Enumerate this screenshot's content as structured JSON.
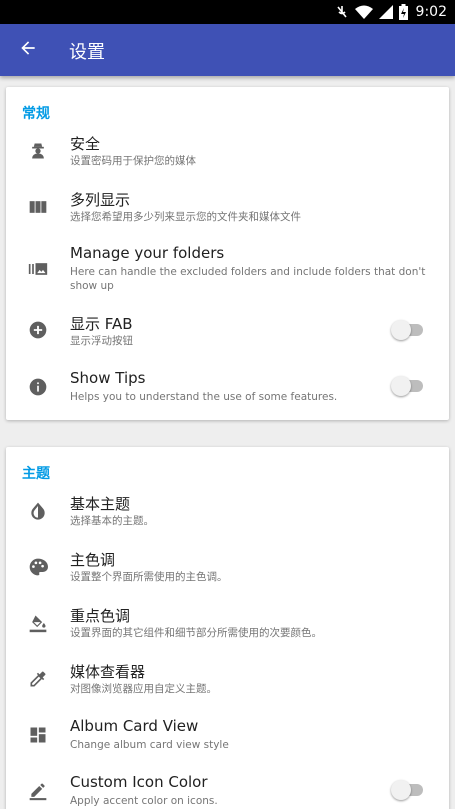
{
  "status_bar": {
    "time": "9:02"
  },
  "app_bar": {
    "title": "设置"
  },
  "sections": {
    "general": {
      "title": "常规",
      "items": [
        {
          "title": "安全",
          "subtitle": "设置密码用于保护您的媒体",
          "icon": "security-guard-icon"
        },
        {
          "title": "多列显示",
          "subtitle": "选择您希望用多少列来显示您的文件夹和媒体文件",
          "icon": "view-columns-icon"
        },
        {
          "title": "Manage your folders",
          "subtitle": "Here can handle the excluded folders and include folders that don't show up",
          "icon": "folder-manage-icon"
        },
        {
          "title": "显示 FAB",
          "subtitle": "显示浮动按钮",
          "icon": "add-circle-icon",
          "toggle": false
        },
        {
          "title": "Show Tips",
          "subtitle": "Helps you to understand the use of some features.",
          "icon": "info-icon",
          "toggle": false
        }
      ]
    },
    "theme": {
      "title": "主题",
      "items": [
        {
          "title": "基本主题",
          "subtitle": "选择基本的主题。",
          "icon": "invert-colors-icon"
        },
        {
          "title": "主色调",
          "subtitle": "设置整个界面所需使用的主色调。",
          "icon": "palette-icon"
        },
        {
          "title": "重点色调",
          "subtitle": "设置界面的其它组件和细节部分所需使用的次要颜色。",
          "icon": "format-color-fill-icon"
        },
        {
          "title": "媒体查看器",
          "subtitle": "对图像浏览器应用自定义主题。",
          "icon": "eyedropper-icon"
        },
        {
          "title": "Album Card View",
          "subtitle": "Change album card view style",
          "icon": "dashboard-icon"
        },
        {
          "title": "Custom Icon Color",
          "subtitle": "Apply accent color on icons.",
          "icon": "edit-pencil-icon",
          "toggle": false
        }
      ]
    }
  },
  "colors": {
    "app_bar": "#3f51b5",
    "section_title": "#039be5",
    "icon": "#5f5f5f"
  }
}
